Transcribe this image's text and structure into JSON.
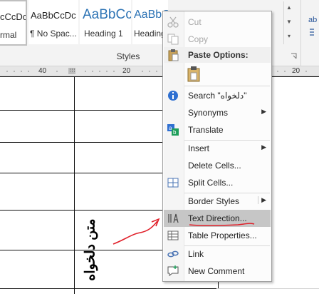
{
  "ribbon": {
    "styles": [
      {
        "sample": "cCcDc",
        "name": "rmal"
      },
      {
        "sample": "AaBbCcDc",
        "name": "¶ No Spac..."
      },
      {
        "sample": "AaBbCc",
        "name": "Heading 1"
      },
      {
        "sample": "AaBbC",
        "name": "Heading"
      }
    ],
    "group_label": "Styles",
    "right_glyph": "ab"
  },
  "ruler": {
    "labels": [
      "40",
      "20",
      "20"
    ]
  },
  "document": {
    "rotated_cell_text": "متن دلخواه"
  },
  "context_menu": {
    "cut": {
      "label": "Cut",
      "accel": "t",
      "disabled": true
    },
    "copy": {
      "label": "Copy",
      "disabled": true
    },
    "paste_header": "Paste Options:",
    "search": {
      "label": "Search \"دلخواه\""
    },
    "synonyms": {
      "label": "Synonyms"
    },
    "translate": {
      "label": "Translate"
    },
    "insert": {
      "label": "Insert"
    },
    "delete_cells": {
      "label": "Delete Cells..."
    },
    "split_cells": {
      "label": "Split Cells..."
    },
    "border_styles": {
      "label": "Border Styles"
    },
    "text_direction": {
      "label": "Text Direction..."
    },
    "table_properties": {
      "label": "Table Properties..."
    },
    "link": {
      "label": "Link"
    },
    "new_comment": {
      "label": "New Comment"
    }
  },
  "colors": {
    "heading": "#2e74b5",
    "highlight": "#c6c6c6",
    "annotation": "#e0202a",
    "ribbon_bg": "#f3f3f3"
  }
}
